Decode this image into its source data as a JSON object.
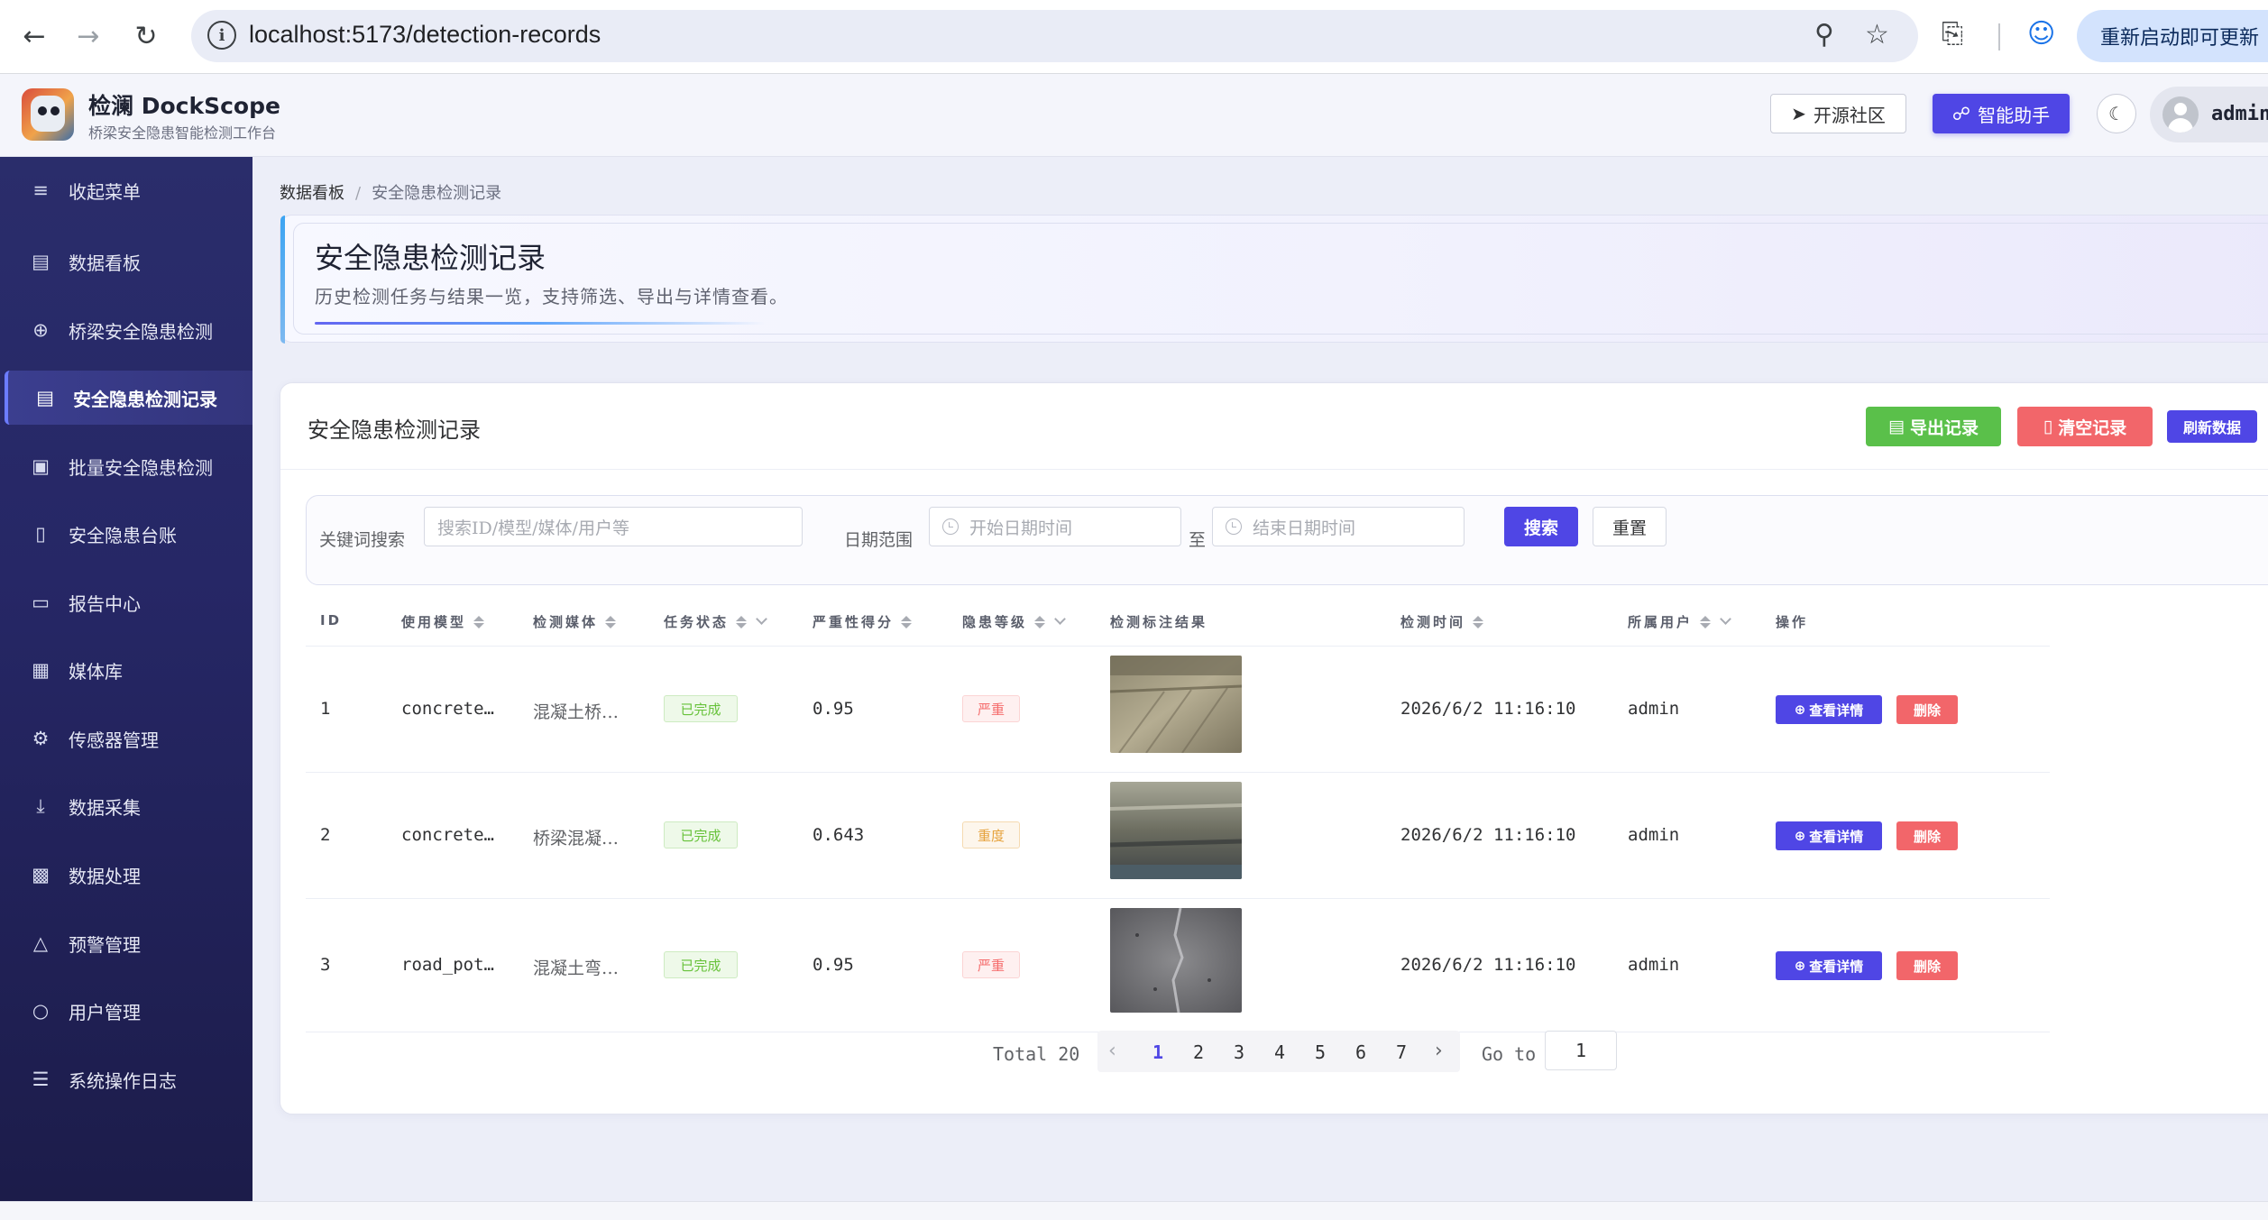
{
  "browser": {
    "url": "localhost:5173/detection-records",
    "update_label": "重新启动即可更新"
  },
  "header": {
    "app_name": "检澜 DockScope",
    "app_subtitle": "桥梁安全隐患智能检测工作台",
    "community_label": "开源社区",
    "assistant_label": "智能助手",
    "user_name": "admin"
  },
  "sidebar": {
    "items": [
      {
        "label": "收起菜单",
        "icon": "menu-fold-icon"
      },
      {
        "label": "数据看板",
        "icon": "dashboard-icon"
      },
      {
        "label": "桥梁安全隐患检测",
        "icon": "target-icon"
      },
      {
        "label": "安全隐患检测记录",
        "icon": "document-icon",
        "active": true
      },
      {
        "label": "批量安全隐患检测",
        "icon": "batch-icon"
      },
      {
        "label": "安全隐患台账",
        "icon": "ledger-icon"
      },
      {
        "label": "报告中心",
        "icon": "folder-icon"
      },
      {
        "label": "媒体库",
        "icon": "picture-icon"
      },
      {
        "label": "传感器管理",
        "icon": "chip-icon"
      },
      {
        "label": "数据采集",
        "icon": "download-icon"
      },
      {
        "label": "数据处理",
        "icon": "data-process-icon"
      },
      {
        "label": "预警管理",
        "icon": "bell-icon"
      },
      {
        "label": "用户管理",
        "icon": "user-icon"
      },
      {
        "label": "系统操作日志",
        "icon": "sliders-icon"
      }
    ]
  },
  "breadcrumb": {
    "root": "数据看板",
    "current": "安全隐患检测记录"
  },
  "hero": {
    "title": "安全隐患检测记录",
    "description": "历史检测任务与结果一览，支持筛选、导出与详情查看。"
  },
  "card": {
    "title": "安全隐患检测记录",
    "export_label": "导出记录",
    "clear_label": "清空记录",
    "refresh_label": "刷新数据"
  },
  "filter": {
    "keyword_label": "关键词搜索",
    "keyword_placeholder": "搜索ID/模型/媒体/用户等",
    "date_label": "日期范围",
    "start_placeholder": "开始日期时间",
    "to_label": "至",
    "end_placeholder": "结束日期时间",
    "search_label": "搜索",
    "reset_label": "重置"
  },
  "table": {
    "headers": [
      "ID",
      "使用模型",
      "检测媒体",
      "任务状态",
      "严重性得分",
      "隐患等级",
      "检测标注结果",
      "检测时间",
      "所属用户",
      "操作"
    ],
    "view_label": "查看详情",
    "delete_label": "删除",
    "rows": [
      {
        "id": "1",
        "model": "concrete…",
        "media": "混凝土桥…",
        "status": "已完成",
        "score": "0.95",
        "level": "严重",
        "level_kind": "severe",
        "time": "2026/6/2 11:16:10",
        "user": "admin"
      },
      {
        "id": "2",
        "model": "concrete…",
        "media": "桥梁混凝…",
        "status": "已完成",
        "score": "0.643",
        "level": "重度",
        "level_kind": "heavy",
        "time": "2026/6/2 11:16:10",
        "user": "admin"
      },
      {
        "id": "3",
        "model": "road_pot…",
        "media": "混凝土弯…",
        "status": "已完成",
        "score": "0.95",
        "level": "严重",
        "level_kind": "severe",
        "time": "2026/6/2 11:16:10",
        "user": "admin"
      }
    ]
  },
  "pagination": {
    "total_label": "Total 20",
    "pages": [
      "1",
      "2",
      "3",
      "4",
      "5",
      "6",
      "7"
    ],
    "current_page": "1",
    "goto_label": "Go to",
    "goto_value": "1"
  }
}
